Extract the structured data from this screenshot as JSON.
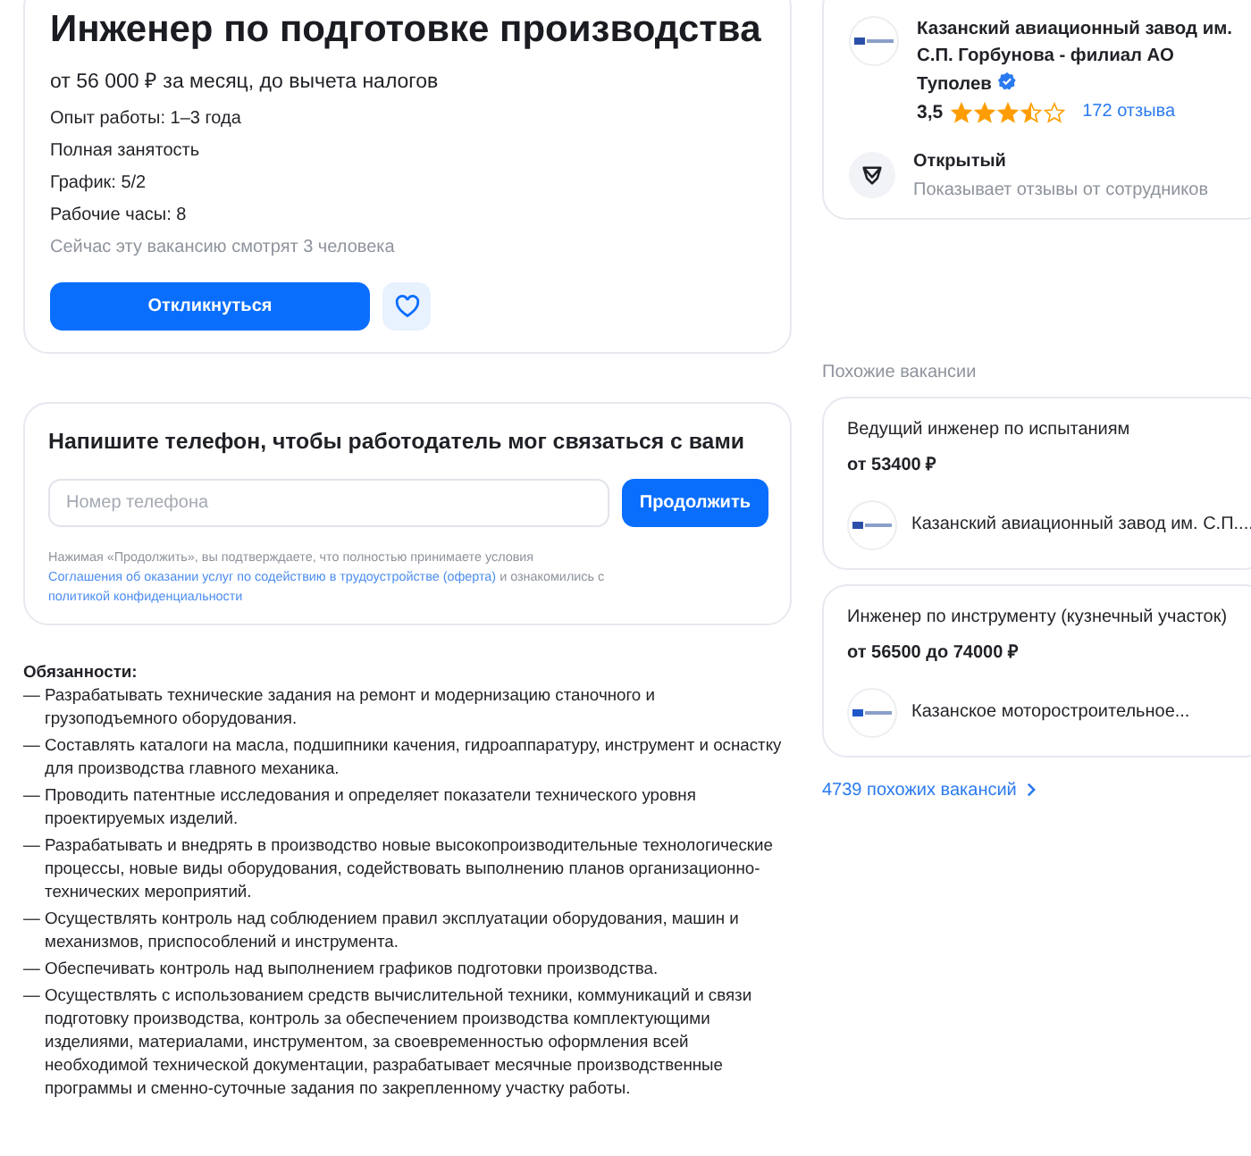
{
  "vacancy": {
    "title": "Инженер по подготовке производства",
    "salary": "от 56 000 ₽ за месяц, до вычета налогов",
    "facts": [
      "Опыт работы: 1–3 года",
      "Полная занятость",
      "График: 5/2",
      "Рабочие часы: 8"
    ],
    "viewers": "Сейчас эту вакансию смотрят 3 человека",
    "apply_button": "Откликнуться",
    "favorite": false
  },
  "phone_form": {
    "title": "Напишите телефон, чтобы работодатель мог связаться с вами",
    "placeholder": "Номер телефона",
    "button": "Продолжить",
    "consent": [
      {
        "kind": "text",
        "text": "Нажимая «Продолжить», вы подтверждаете, что полностью принимаете условия "
      },
      {
        "kind": "link",
        "text": "Соглашения об оказании услуг по содействию в трудоустройстве (оферта)"
      },
      {
        "kind": "text",
        "text": " и ознакомились с "
      },
      {
        "kind": "link",
        "text": "политикой конфиденциальности"
      }
    ]
  },
  "duties": {
    "heading": "Обязанности:",
    "items": [
      "— Разрабатывать технические задания на ремонт и модернизацию станочного и грузоподъемного оборудования.",
      "— Составлять каталоги на масла, подшипники качения, гидроаппаратуру, инструмент и оснастку для производства главного механика.",
      "— Проводить патентные исследования и определяет показатели технического уровня проектируемых изделий.",
      "— Разрабатывать и внедрять в производство новые высокопроизводительные технологические процессы, новые виды оборудования, содействовать выполнению планов организационно-технических мероприятий.",
      "— Осуществлять контроль над соблюдением правил эксплуатации оборудования, машин и механизмов, приспособлений и инструмента.",
      "— Обеспечивать контроль над выполнением графиков подготовки производства.",
      "— Осуществлять с использованием средств вычислительной техники, коммуникаций и связи подготовку производства, контроль за обеспечением производства комплектующими изделиями, материалами, инструментом, за своевременностью оформления всей необходимой технической документации, разрабатывает месячные производственные программы и сменно-суточные задания по закрепленному участку работы."
    ]
  },
  "company": {
    "name": "Казанский авиационный завод им. С.П. Горбунова - филиал АО Туполев",
    "verified": true,
    "rating": "3,5",
    "stars": 3.5,
    "reviews": "172 отзыва",
    "feature_title": "Открытый",
    "feature_text": "Показывает отзывы от сотрудников"
  },
  "similar": {
    "heading": "Похожие вакансии",
    "items": [
      {
        "title": "Ведущий инженер по испытаниям",
        "salary": "от 53400 ₽",
        "company": "Казанский авиационный завод им. С.П...."
      },
      {
        "title": "Инженер по инструменту (кузнечный участок)",
        "salary": "от 56500 до 74000 ₽",
        "company": "Казанское моторостроительное..."
      }
    ],
    "more_link": "4739 похожих вакансий"
  }
}
